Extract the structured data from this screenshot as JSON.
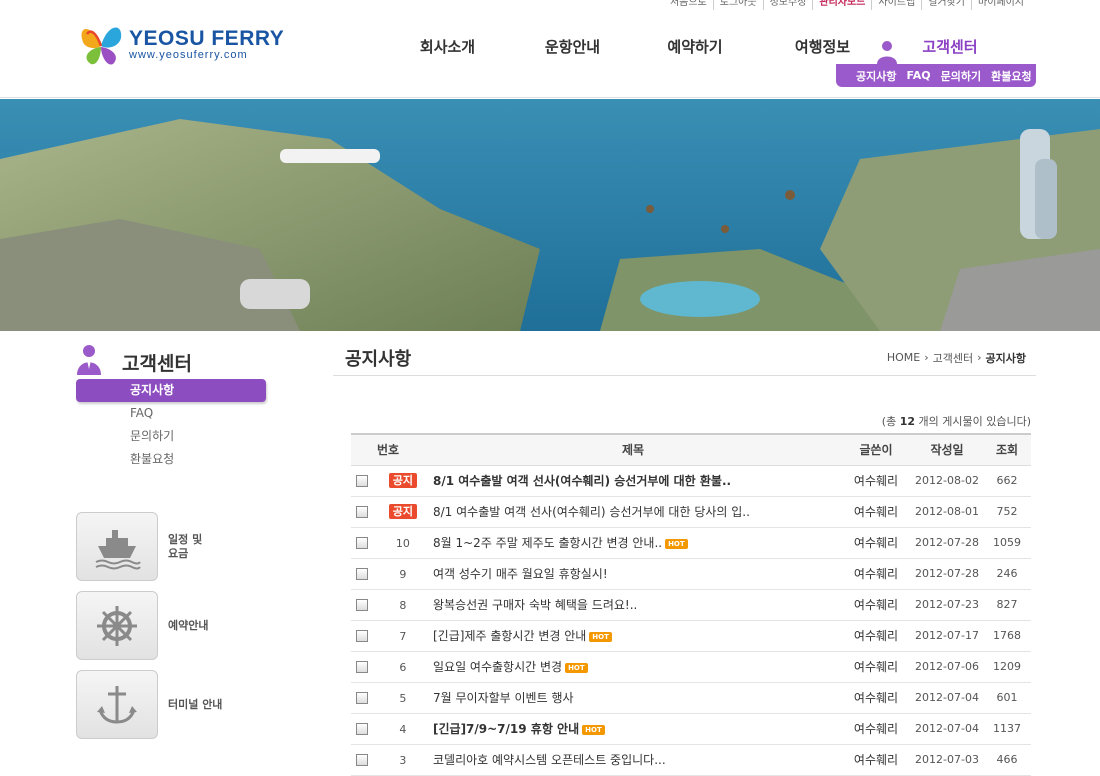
{
  "topbar": {
    "links": [
      "처음으로",
      "로그아웃",
      "정보수정",
      "관리자모드",
      "사이트맵",
      "길거찾기",
      "마이페이지"
    ],
    "active_index": 3
  },
  "logo": {
    "name": "YEOSU FERRY",
    "url": "www.yeosuferry.com"
  },
  "gnb": {
    "items": [
      "회사소개",
      "운항안내",
      "예약하기",
      "여행정보",
      "고객센터"
    ],
    "active_index": 4
  },
  "subnav": {
    "items": [
      "공지사항",
      "FAQ",
      "문의하기",
      "환불요청"
    ]
  },
  "sidebar": {
    "title": "고객센터",
    "menu": [
      "공지사항",
      "FAQ",
      "문의하기",
      "환불요청"
    ],
    "active_index": 0
  },
  "quick_links": [
    {
      "label": "일정 및\n요금",
      "icon": "ship-icon"
    },
    {
      "label": "예약안내",
      "icon": "helm-icon"
    },
    {
      "label": "터미널 안내",
      "icon": "anchor-icon"
    }
  ],
  "content": {
    "title": "공지사항",
    "breadcrumb": [
      "HOME",
      "고객센터",
      "공지사항"
    ],
    "total_prefix": "(총",
    "total_count": "12",
    "total_suffix": "개의 게시물이 있습니다)"
  },
  "table": {
    "headers": [
      "번호",
      "제목",
      "글쓴이",
      "작성일",
      "조회"
    ],
    "rows": [
      {
        "num": "공지",
        "notice": true,
        "subject": "8/1 여수출발 여객 선사(여수훼리) 승선거부에 대한 환불..",
        "bold": true,
        "hot": false,
        "writer": "여수훼리",
        "date": "2012-08-02",
        "views": "662"
      },
      {
        "num": "공지",
        "notice": true,
        "subject": "8/1 여수출발 여객 선사(여수훼리) 승선거부에 대한 당사의 입..",
        "bold": false,
        "hot": false,
        "writer": "여수훼리",
        "date": "2012-08-01",
        "views": "752"
      },
      {
        "num": "10",
        "notice": false,
        "subject": "8월 1~2주 주말 제주도 출항시간 변경 안내..",
        "bold": false,
        "hot": true,
        "writer": "여수훼리",
        "date": "2012-07-28",
        "views": "1059"
      },
      {
        "num": "9",
        "notice": false,
        "subject": "여객 성수기 매주 월요일 휴항실시!",
        "bold": false,
        "hot": false,
        "writer": "여수훼리",
        "date": "2012-07-28",
        "views": "246"
      },
      {
        "num": "8",
        "notice": false,
        "subject": "왕복승선권 구매자 숙박 혜택을 드려요!..",
        "bold": false,
        "hot": false,
        "writer": "여수훼리",
        "date": "2012-07-23",
        "views": "827"
      },
      {
        "num": "7",
        "notice": false,
        "subject": "[긴급]제주 출항시간 변경 안내",
        "bold": false,
        "hot": true,
        "writer": "여수훼리",
        "date": "2012-07-17",
        "views": "1768"
      },
      {
        "num": "6",
        "notice": false,
        "subject": "일요일 여수출항시간 변경",
        "bold": false,
        "hot": true,
        "writer": "여수훼리",
        "date": "2012-07-06",
        "views": "1209"
      },
      {
        "num": "5",
        "notice": false,
        "subject": "7월 무이자할부 이벤트 행사",
        "bold": false,
        "hot": false,
        "writer": "여수훼리",
        "date": "2012-07-04",
        "views": "601"
      },
      {
        "num": "4",
        "notice": false,
        "subject": "[긴급]7/9~7/19 휴항 안내",
        "bold": true,
        "hot": true,
        "writer": "여수훼리",
        "date": "2012-07-04",
        "views": "1137"
      },
      {
        "num": "3",
        "notice": false,
        "subject": "코델리아호 예약시스템 오픈테스트 중입니다...",
        "bold": false,
        "hot": false,
        "writer": "여수훼리",
        "date": "2012-07-03",
        "views": "466"
      }
    ],
    "hot_label": "HOT"
  },
  "colors": {
    "accent": "#8c4dc0",
    "brand": "#1a55a3",
    "notice": "#ea4b2d",
    "hot": "#f39800"
  }
}
